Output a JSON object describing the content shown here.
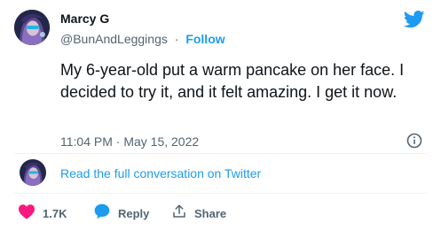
{
  "author": {
    "name": "Marcy G",
    "handle": "@BunAndLeggings",
    "separator": "·",
    "follow_label": "Follow",
    "avatar_icon": "profile-photo"
  },
  "tweet": {
    "text": "My 6-year-old put a warm pancake on her face. I decided to try it, and it felt amazing. I get it now.",
    "timestamp": "11:04 PM · May 15, 2022"
  },
  "conversation": {
    "link_label": "Read the full conversation on Twitter"
  },
  "actions": {
    "like_count": "1.7K",
    "reply_label": "Reply",
    "share_label": "Share"
  },
  "icons": {
    "brand": "twitter-bird-icon",
    "info": "info-icon",
    "like": "heart-icon",
    "reply": "speech-bubble-icon",
    "share": "share-upload-icon"
  },
  "colors": {
    "brand_blue": "#1d9bf0",
    "like_red": "#f91880",
    "text_primary": "#0f1419",
    "text_secondary": "#536471",
    "divider": "#eff3f4"
  }
}
